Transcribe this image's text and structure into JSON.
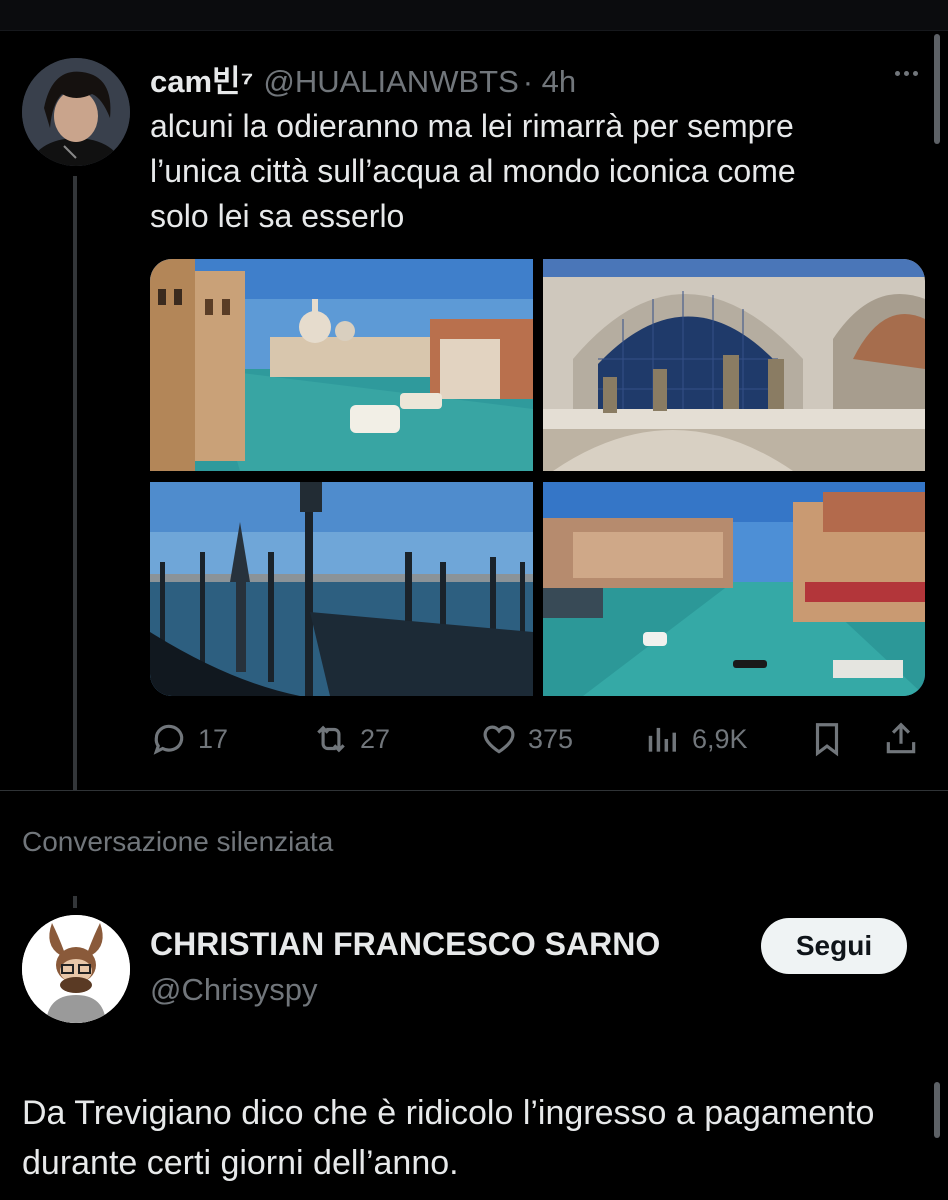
{
  "tweet1": {
    "display_name": "cam빈⁷",
    "handle": "@HUALIANWBTS",
    "time": "· 4h",
    "text": "alcuni la odieranno ma lei rimarrà per sempre\nl’unica città sull’acqua al mondo iconica come\nsolo lei sa esserlo",
    "media": [
      "grand-canal-photo",
      "st-marks-basilica-photo",
      "gondola-pier-photo",
      "canal-boats-photo"
    ],
    "stats": {
      "replies": "17",
      "reposts": "27",
      "likes": "375",
      "views": "6,9K"
    }
  },
  "muted_label": "Conversazione silenziata",
  "tweet2": {
    "display_name": "CHRISTIAN FRANCESCO SARNO",
    "handle": "@Chrisyspy",
    "follow_label": "Segui",
    "text": "Da Trevigiano dico che è ridicolo l’ingresso a pagamento durante certi giorni dell’anno."
  },
  "colors": {
    "background": "#000000",
    "text": "#e7e9ea",
    "secondary": "#71767b",
    "divider": "#2f3336"
  }
}
